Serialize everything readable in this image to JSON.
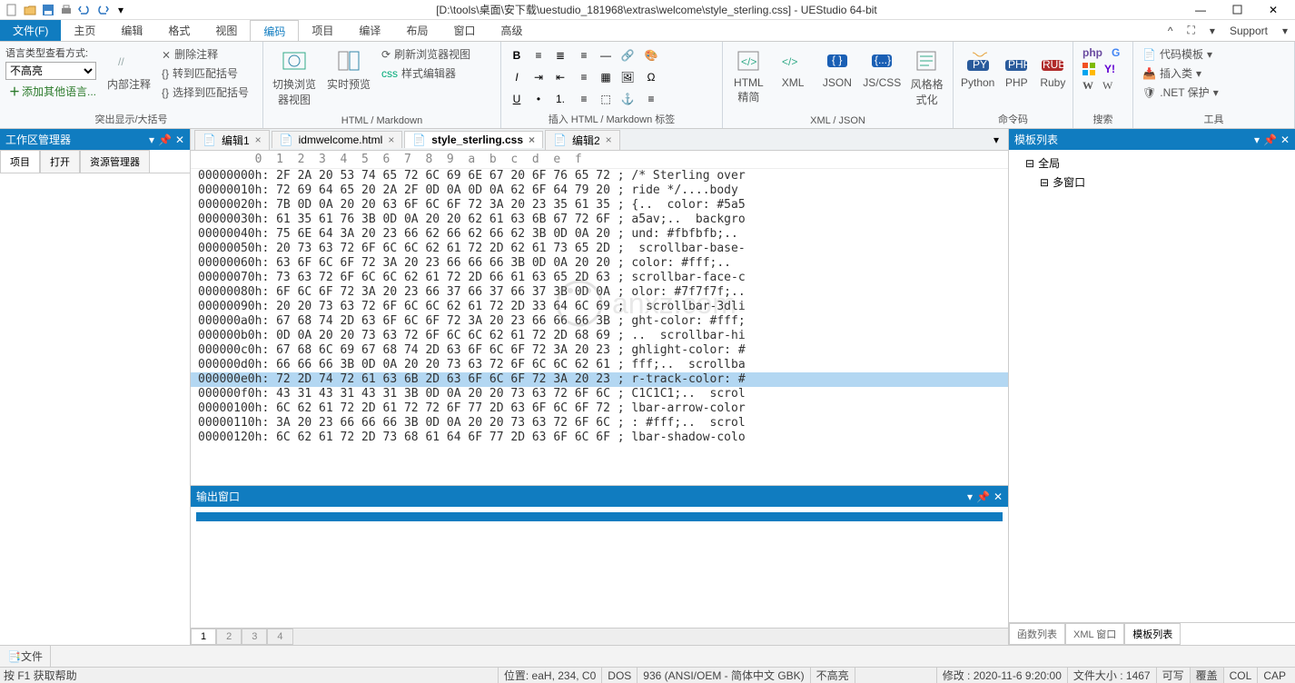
{
  "title": "[D:\\tools\\桌面\\安下载\\uestudio_181968\\extras\\welcome\\style_sterling.css] - UEStudio 64-bit",
  "support": "Support",
  "menus": {
    "file": "文件(F)",
    "home": "主页",
    "edit": "编辑",
    "format": "格式",
    "view": "视图",
    "encoding": "编码",
    "project": "项目",
    "compile": "编译",
    "layout": "布局",
    "window": "窗口",
    "advanced": "高级"
  },
  "ribbon": {
    "g1": {
      "label": "突出显示/大括号",
      "syntax_label": "语言类型查看方式:",
      "syntax_value": "不高亮",
      "add_lang": "添加其他语言...",
      "inner_comment": "内部注释",
      "del_comment": "删除注释",
      "to_match": "转到匹配括号",
      "sel_match": "选择到匹配括号"
    },
    "g2": {
      "label": "HTML / Markdown",
      "switch_view": "切换浏览器视图",
      "rt_preview": "实时预览",
      "refresh": "刷新浏览器视图",
      "style_editor": "样式编辑器"
    },
    "g3": {
      "label": "插入 HTML / Markdown 标签"
    },
    "g4": {
      "label": "XML / JSON",
      "html": "HTML 精简",
      "xml": "XML",
      "json": "JSON",
      "jscss": "JS/CSS",
      "style": "风格格式化"
    },
    "g5": {
      "label": "命令码",
      "python": "Python",
      "php": "PHP",
      "ruby": "Ruby"
    },
    "g6": {
      "label": "搜索",
      "php": "php"
    },
    "g7": {
      "label": "工具",
      "tpl": "代码模板",
      "ins": "插入类",
      "net": ".NET 保护"
    }
  },
  "workspace": {
    "title": "工作区管理器",
    "tabs": [
      "项目",
      "打开",
      "资源管理器"
    ]
  },
  "filetabs": [
    {
      "name": "编辑1",
      "active": false
    },
    {
      "name": "idmwelcome.html",
      "active": false
    },
    {
      "name": "style_sterling.css",
      "active": true
    },
    {
      "name": "编辑2",
      "active": false
    }
  ],
  "ruler": "        0  1  2  3  4  5  6  7  8  9  a  b  c  d  e  f",
  "hexlines": [
    {
      "addr": "00000000h",
      "hex": "2F 2A 20 53 74 65 72 6C 69 6E 67 20 6F 76 65 72",
      "ascii": "/* Sterling over",
      "sel": false
    },
    {
      "addr": "00000010h",
      "hex": "72 69 64 65 20 2A 2F 0D 0A 0D 0A 62 6F 64 79 20",
      "ascii": "ride */....body ",
      "sel": false
    },
    {
      "addr": "00000020h",
      "hex": "7B 0D 0A 20 20 63 6F 6C 6F 72 3A 20 23 35 61 35",
      "ascii": "{..  color: #5a5",
      "sel": false
    },
    {
      "addr": "00000030h",
      "hex": "61 35 61 76 3B 0D 0A 20 20 62 61 63 6B 67 72 6F",
      "ascii": "a5av;..  backgro",
      "sel": false
    },
    {
      "addr": "00000040h",
      "hex": "75 6E 64 3A 20 23 66 62 66 62 66 62 3B 0D 0A 20",
      "ascii": "und: #fbfbfb;.. ",
      "sel": false
    },
    {
      "addr": "00000050h",
      "hex": "20 73 63 72 6F 6C 6C 62 61 72 2D 62 61 73 65 2D",
      "ascii": " scrollbar-base-",
      "sel": false
    },
    {
      "addr": "00000060h",
      "hex": "63 6F 6C 6F 72 3A 20 23 66 66 66 3B 0D 0A 20 20",
      "ascii": "color: #fff;..  ",
      "sel": false
    },
    {
      "addr": "00000070h",
      "hex": "73 63 72 6F 6C 6C 62 61 72 2D 66 61 63 65 2D 63",
      "ascii": "scrollbar-face-c",
      "sel": false
    },
    {
      "addr": "00000080h",
      "hex": "6F 6C 6F 72 3A 20 23 66 37 66 37 66 37 3B 0D 0A",
      "ascii": "olor: #7f7f7f;..",
      "sel": false
    },
    {
      "addr": "00000090h",
      "hex": "20 20 73 63 72 6F 6C 6C 62 61 72 2D 33 64 6C 69",
      "ascii": "  scrollbar-3dli",
      "sel": false
    },
    {
      "addr": "000000a0h",
      "hex": "67 68 74 2D 63 6F 6C 6F 72 3A 20 23 66 66 66 3B",
      "ascii": "ght-color: #fff;",
      "sel": false
    },
    {
      "addr": "000000b0h",
      "hex": "0D 0A 20 20 73 63 72 6F 6C 6C 62 61 72 2D 68 69",
      "ascii": "..  scrollbar-hi",
      "sel": false
    },
    {
      "addr": "000000c0h",
      "hex": "67 68 6C 69 67 68 74 2D 63 6F 6C 6F 72 3A 20 23",
      "ascii": "ghlight-color: #",
      "sel": false
    },
    {
      "addr": "000000d0h",
      "hex": "66 66 66 3B 0D 0A 20 20 73 63 72 6F 6C 6C 62 61",
      "ascii": "fff;..  scrollba",
      "sel": false
    },
    {
      "addr": "000000e0h",
      "hex": "72 2D 74 72 61 63 6B 2D 63 6F 6C 6F 72 3A 20 23",
      "ascii": "r-track-color: #",
      "sel": true
    },
    {
      "addr": "000000f0h",
      "hex": "43 31 43 31 43 31 3B 0D 0A 20 20 73 63 72 6F 6C",
      "ascii": "C1C1C1;..  scrol",
      "sel": false
    },
    {
      "addr": "00000100h",
      "hex": "6C 62 61 72 2D 61 72 72 6F 77 2D 63 6F 6C 6F 72",
      "ascii": "lbar-arrow-color",
      "sel": false
    },
    {
      "addr": "00000110h",
      "hex": "3A 20 23 66 66 66 3B 0D 0A 20 20 73 63 72 6F 6C",
      "ascii": ": #fff;..  scrol",
      "sel": false
    },
    {
      "addr": "00000120h",
      "hex": "6C 62 61 72 2D 73 68 61 64 6F 77 2D 63 6F 6C 6F",
      "ascii": "lbar-shadow-colo",
      "sel": false
    }
  ],
  "output": {
    "title": "输出窗口",
    "tabs": [
      "1",
      "2",
      "3",
      "4"
    ]
  },
  "rpanel": {
    "title": "模板列表",
    "items": [
      "全局",
      "多窗口"
    ],
    "bottom_tabs": [
      "函数列表",
      "XML 窗口",
      "模板列表"
    ]
  },
  "footer_left": "文件",
  "status": {
    "help": "按 F1 获取帮助",
    "pos": "位置: eaH, 234, C0",
    "dos": "DOS",
    "cp": "936  (ANSI/OEM - 简体中文 GBK)",
    "hl": "不高亮",
    "mod": "修改 : 2020-11-6 9:20:00",
    "size": "文件大小 : 1467",
    "rw": "可写",
    "ovr": "覆盖",
    "col": "COL",
    "cap": "CAP"
  }
}
